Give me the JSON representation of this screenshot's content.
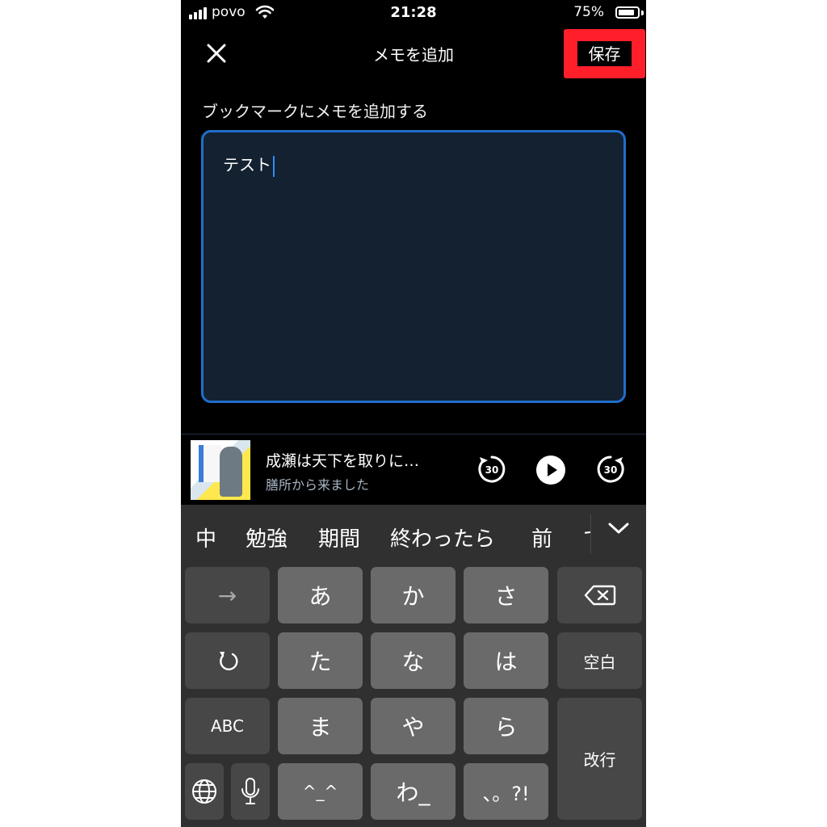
{
  "status_bar": {
    "carrier": "povo",
    "time": "21:28",
    "battery": "75%"
  },
  "header": {
    "title": "メモを追加",
    "save_label": "保存"
  },
  "memo": {
    "label": "ブックマークにメモを追加する",
    "value": "テスト"
  },
  "player": {
    "title": "成瀬は天下を取りに…",
    "author": "膳所から来ました",
    "skip_seconds": "30"
  },
  "keyboard": {
    "suggestions": [
      "中",
      "勉強",
      "期間",
      "終わったら",
      "前",
      "で"
    ],
    "keys": {
      "arrow": "→",
      "a": "あ",
      "ka": "か",
      "sa": "さ",
      "ta": "た",
      "na": "な",
      "ha": "は",
      "space": "空白",
      "abc": "ABC",
      "ma": "ま",
      "ya": "や",
      "ra": "ら",
      "enter": "改行",
      "emoticon": "^_^",
      "wa": "わ_",
      "punct": "、。?!"
    }
  }
}
